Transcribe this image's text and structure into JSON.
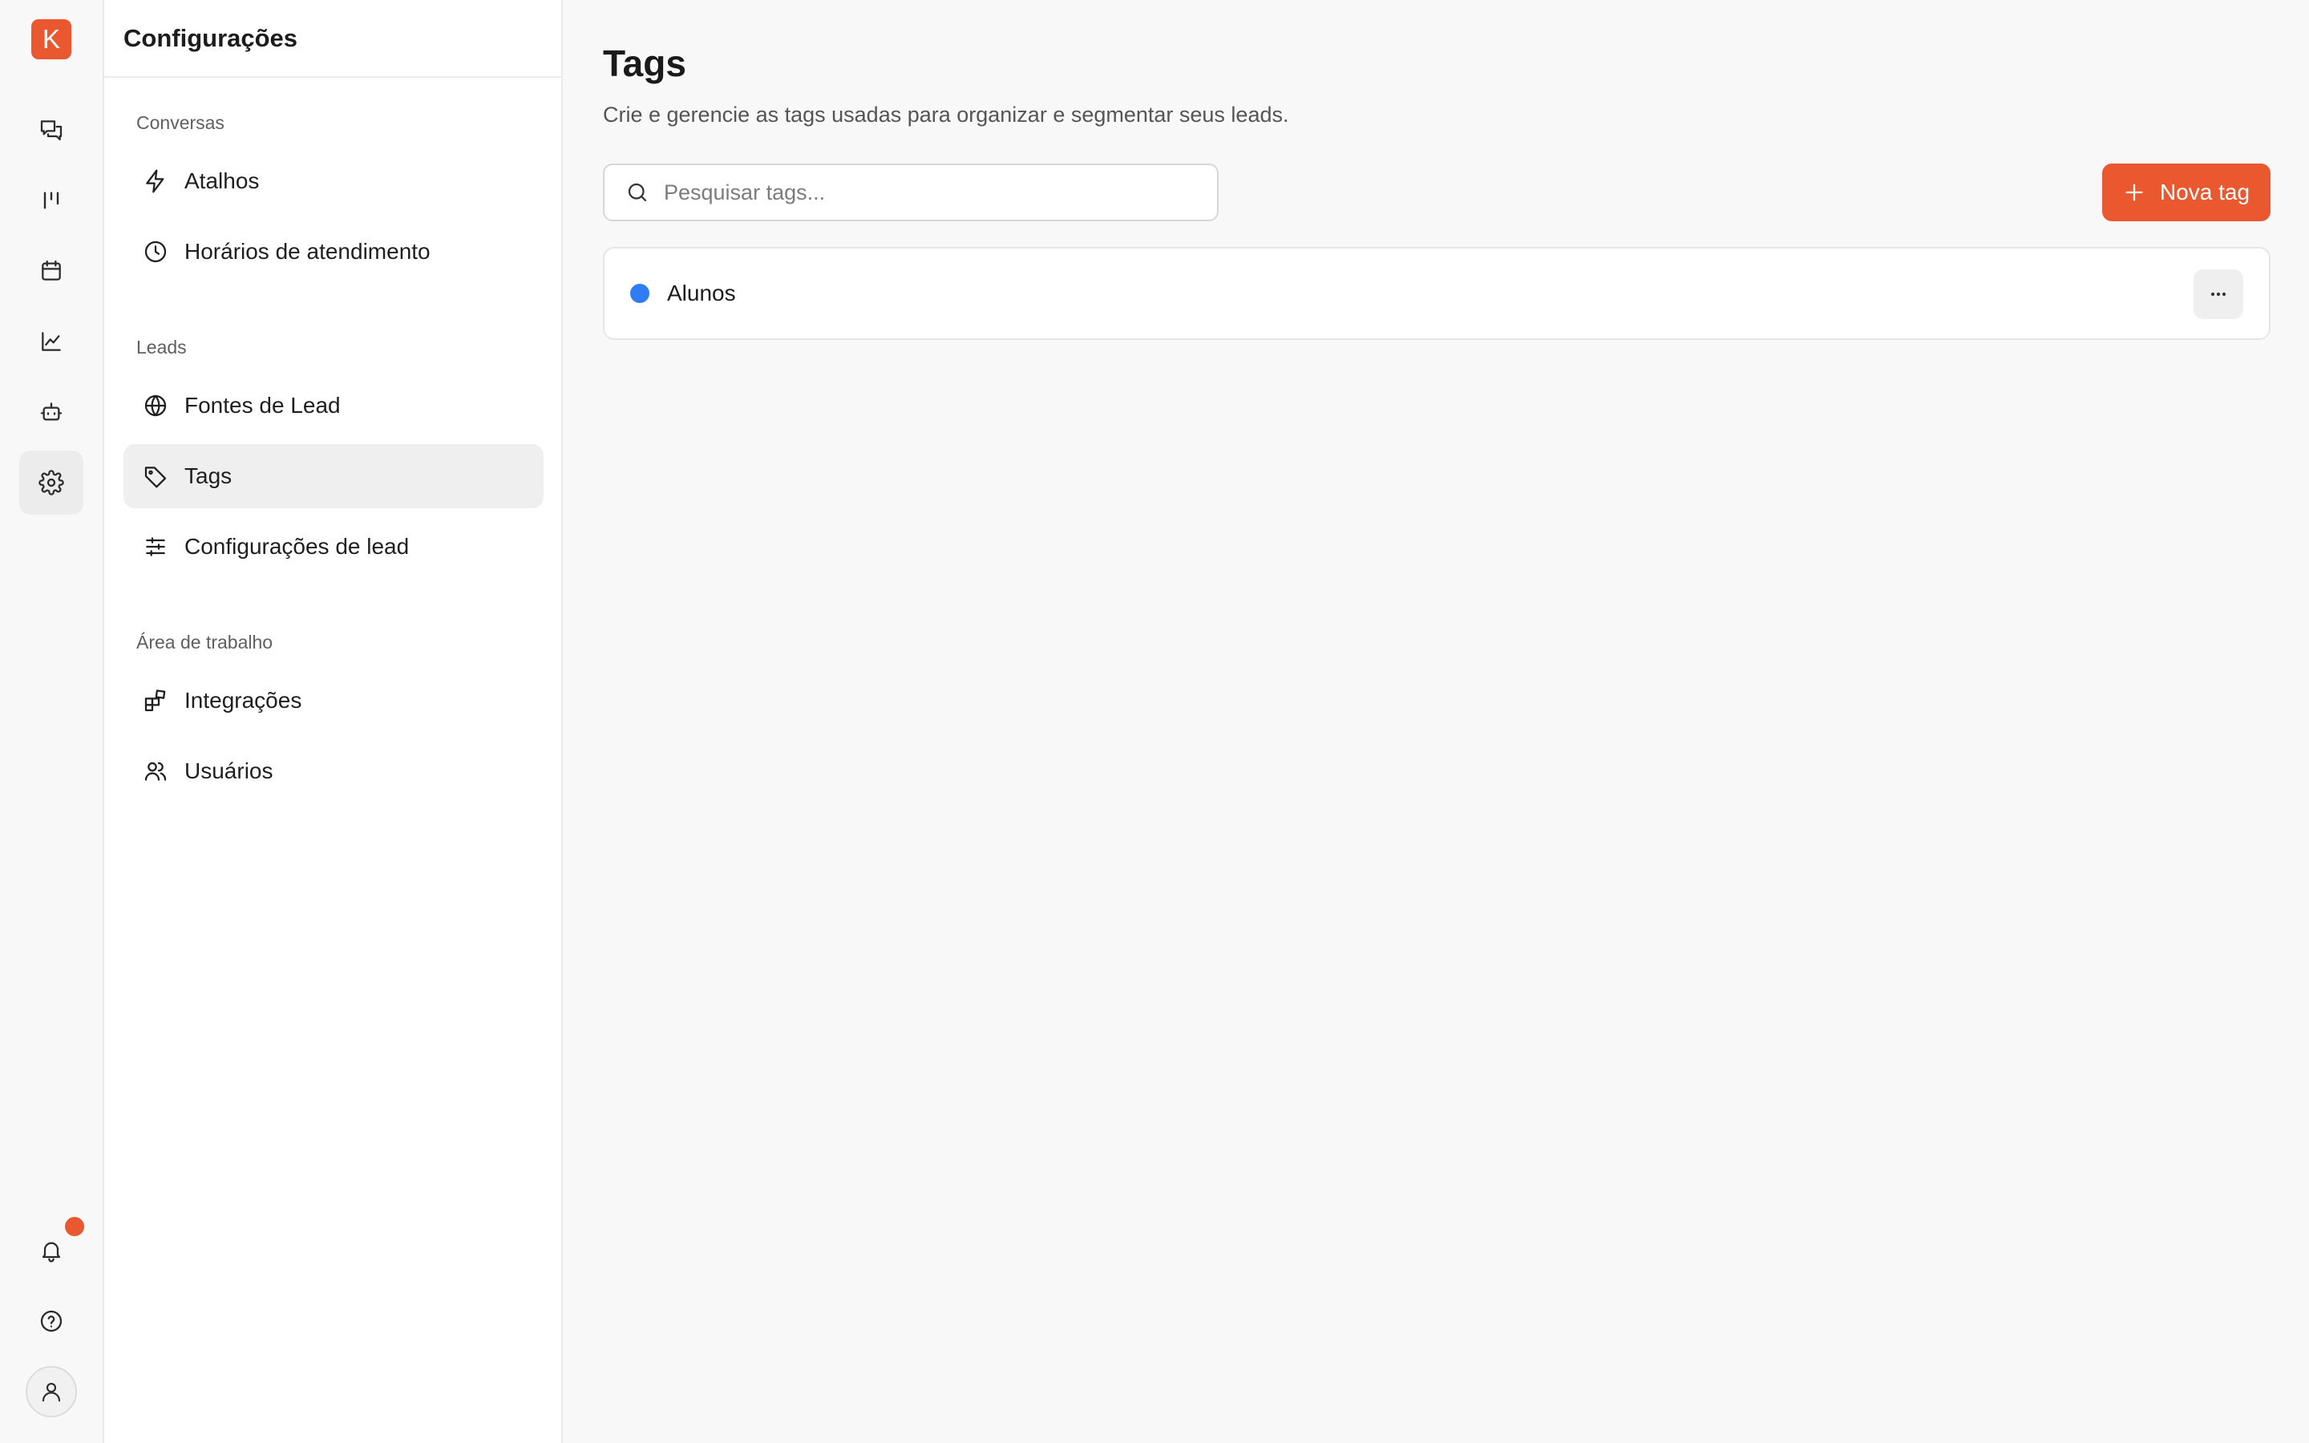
{
  "brand": {
    "logo_letter": "K",
    "accent_color": "#e9582f"
  },
  "rail": {
    "items": [
      {
        "name": "conversations-icon"
      },
      {
        "name": "pipeline-icon"
      },
      {
        "name": "calendar-icon"
      },
      {
        "name": "analytics-icon"
      },
      {
        "name": "bot-icon"
      },
      {
        "name": "settings-icon",
        "active": true
      }
    ],
    "bottom": [
      {
        "name": "bell-icon",
        "has_notification": true
      },
      {
        "name": "help-icon"
      },
      {
        "name": "user-icon"
      }
    ]
  },
  "sidebar": {
    "title": "Configurações",
    "sections": [
      {
        "label": "Conversas",
        "items": [
          {
            "label": "Atalhos",
            "icon": "lightning-icon"
          },
          {
            "label": "Horários de atendimento",
            "icon": "clock-icon"
          }
        ]
      },
      {
        "label": "Leads",
        "items": [
          {
            "label": "Fontes de Lead",
            "icon": "globe-icon"
          },
          {
            "label": "Tags",
            "icon": "tag-icon",
            "active": true
          },
          {
            "label": "Configurações de lead",
            "icon": "sliders-icon"
          }
        ]
      },
      {
        "label": "Área de trabalho",
        "items": [
          {
            "label": "Integrações",
            "icon": "puzzle-icon"
          },
          {
            "label": "Usuários",
            "icon": "users-icon"
          }
        ]
      }
    ]
  },
  "main": {
    "title": "Tags",
    "subtitle": "Crie e gerencie as tags usadas para organizar e segmentar seus leads.",
    "search": {
      "placeholder": "Pesquisar tags...",
      "value": ""
    },
    "new_tag_label": "Nova tag",
    "tags": [
      {
        "name": "Alunos",
        "color": "#2f7cf6"
      }
    ]
  }
}
